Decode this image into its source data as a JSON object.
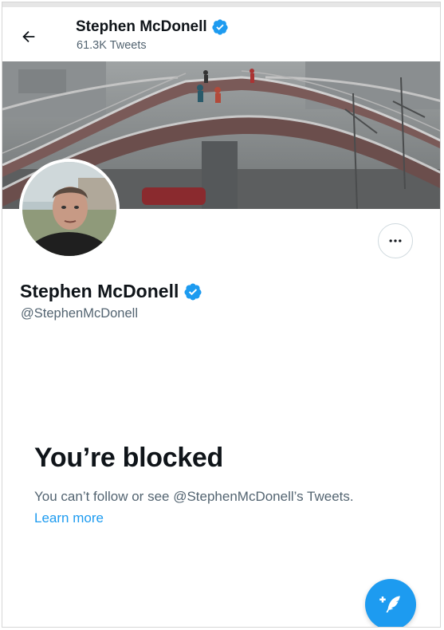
{
  "header": {
    "back_icon": "arrow-left-icon",
    "name": "Stephen McDonell",
    "tweet_count": "61.3K Tweets"
  },
  "profile": {
    "name": "Stephen McDonell",
    "handle": "@StephenMcDonell",
    "verified_icon": "verified-badge-icon",
    "more_icon": "more-horizontal-icon"
  },
  "blocked": {
    "title": "You’re blocked",
    "description": "You can’t follow or see @StephenMcDonell’s Tweets.",
    "learn_more": "Learn more"
  },
  "fab": {
    "icon": "compose-tweet-icon"
  },
  "colors": {
    "accent": "#1d9bf0",
    "text": "#0f1419",
    "secondary": "#536471",
    "border": "#cfd9de"
  }
}
